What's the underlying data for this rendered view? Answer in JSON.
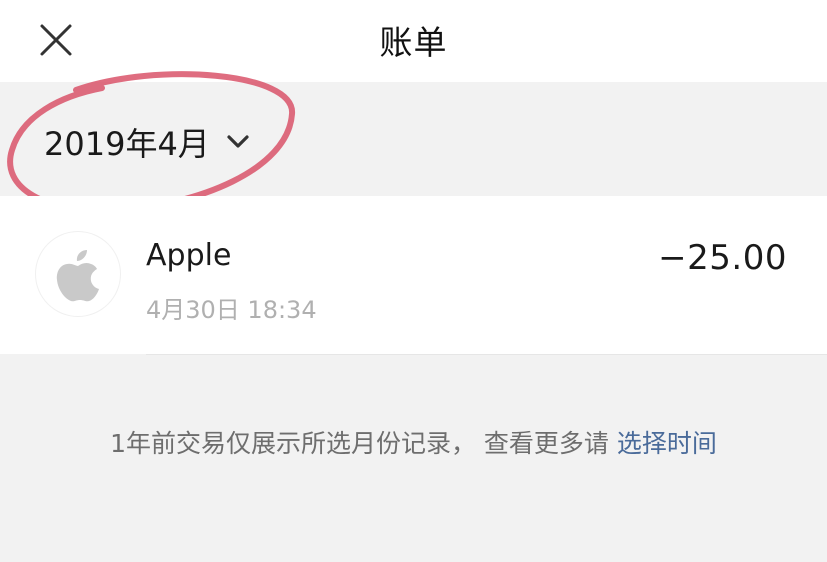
{
  "header": {
    "title": "账单",
    "close_icon": "close-icon"
  },
  "month_filter": {
    "label": "2019年4月",
    "icon": "chevron-down-icon",
    "annotation_color": "#d9546a"
  },
  "transactions": [
    {
      "merchant": "Apple",
      "icon": "apple-logo-icon",
      "time": "4月30日 18:34",
      "amount": "−25.00"
    }
  ],
  "notice": {
    "text": "1年前交易仅展示所选月份记录， 查看更多请 ",
    "link_label": "选择时间",
    "link_color": "#4a6b9a"
  }
}
